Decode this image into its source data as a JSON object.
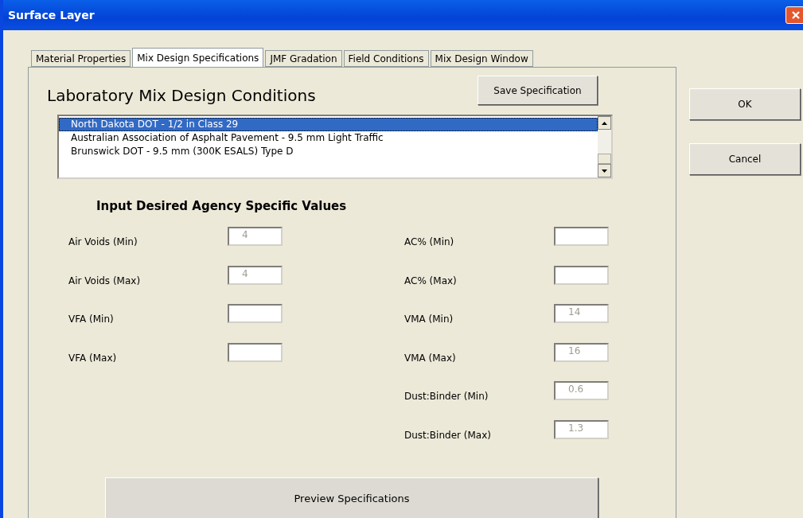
{
  "window": {
    "title": "Surface Layer"
  },
  "tabs": [
    {
      "label": "Material Properties",
      "selected": false
    },
    {
      "label": "Mix Design Specifications",
      "selected": true
    },
    {
      "label": "JMF Gradation",
      "selected": false
    },
    {
      "label": "Field Conditions",
      "selected": false
    },
    {
      "label": "Mix Design Window",
      "selected": false
    }
  ],
  "heading": "Laboratory Mix Design Conditions",
  "save_button": "Save Specification",
  "specifications": [
    {
      "label": "North Dakota DOT - 1/2 in Class 29",
      "selected": true
    },
    {
      "label": "Australian Association of Asphalt Pavement - 9.5 mm Light Traffic",
      "selected": false
    },
    {
      "label": "Brunswick DOT - 9.5 mm (300K ESALS) Type D",
      "selected": false
    }
  ],
  "values_heading": "Input Desired Agency Specific Values",
  "left_fields": [
    {
      "label": "Air Voids (Min)",
      "value": "4"
    },
    {
      "label": "Air Voids (Max)",
      "value": "4"
    },
    {
      "label": "VFA (Min)"
    },
    {
      "label": "VFA (Max)"
    }
  ],
  "right_fields": [
    {
      "label": "AC% (Min)"
    },
    {
      "label": "AC% (Max)"
    },
    {
      "label": "VMA (Min)",
      "value": "14"
    },
    {
      "label": "VMA (Max)",
      "value": "16"
    },
    {
      "label": "Dust:Binder (Min)",
      "value": "0.6"
    },
    {
      "label": "Dust:Binder (Max)",
      "value": "1.3"
    }
  ],
  "preview_button": "Preview Specifications",
  "dialog_buttons": [
    "OK",
    "Cancel"
  ]
}
